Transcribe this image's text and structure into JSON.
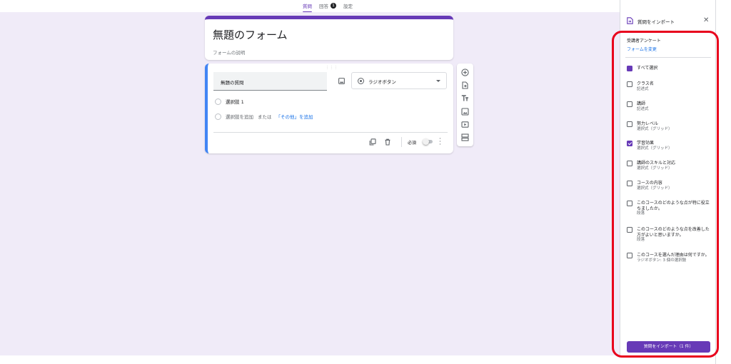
{
  "tabs": [
    {
      "label": "質問",
      "active": true
    },
    {
      "label": "回答",
      "badge": "1"
    },
    {
      "label": "設定"
    }
  ],
  "form": {
    "title": "無題のフォーム",
    "description_placeholder": "フォームの説明"
  },
  "question": {
    "title": "無題の質問",
    "type": "ラジオボタン",
    "option1": "選択肢 1",
    "add_option": "選択肢を追加",
    "or": "または",
    "add_other": "「その他」を追加",
    "required_label": "必須"
  },
  "panel": {
    "title": "質問をインポート",
    "source_name": "受講者アンケート",
    "change_form": "フォームを変更",
    "select_all": "すべて選択",
    "items": [
      {
        "label": "クラス名",
        "sub": "記述式",
        "checked": false
      },
      {
        "label": "講師",
        "sub": "記述式",
        "checked": false
      },
      {
        "label": "努力レベル",
        "sub": "選択式（グリッド）",
        "checked": false
      },
      {
        "label": "学習効果",
        "sub": "選択式（グリッド）",
        "checked": true
      },
      {
        "label": "講師のスキルと対応",
        "sub": "選択式（グリッド）",
        "checked": false
      },
      {
        "label": "コースの内容",
        "sub": "選択式（グリッド）",
        "checked": false
      },
      {
        "label": "このコースのどのような点が特に役立ちましたか。",
        "sub": "段落",
        "checked": false
      },
      {
        "label": "このコースのどのような点を改善した方がよいと思いますか。",
        "sub": "段落",
        "checked": false
      },
      {
        "label": "このコースを選んだ理由は何ですか。",
        "sub": "ラジオボタン: 3 個の選択肢",
        "checked": false
      }
    ],
    "import_button": "質問をインポート（1 件）"
  },
  "colors": {
    "accent": "#673ab7",
    "link": "#1a73e8",
    "annotation": "#e8001c"
  }
}
